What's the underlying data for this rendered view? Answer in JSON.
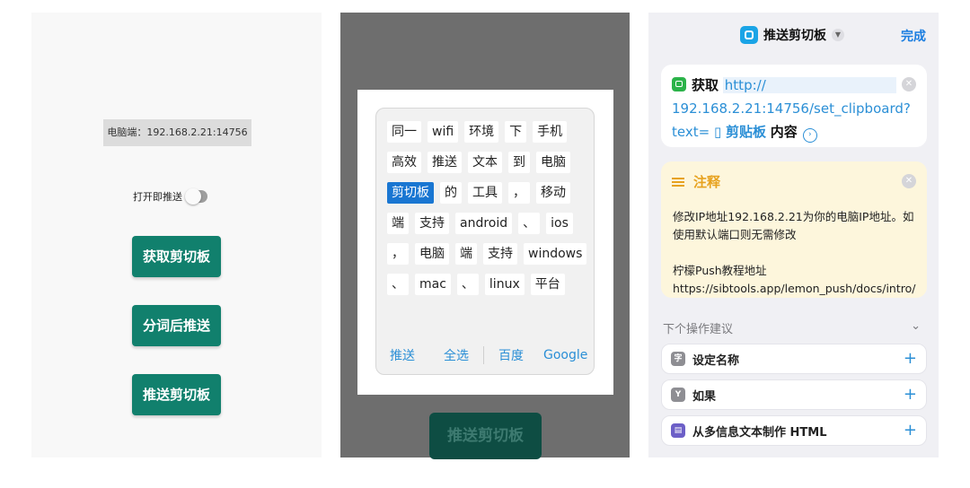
{
  "panel_app": {
    "ip_label": "电脑端：192.168.2.21:14756",
    "toggle_label": "打开即推送",
    "buttons": [
      "获取剪切板",
      "分词后推送",
      "推送剪切板"
    ]
  },
  "panel_dialog": {
    "chips": [
      "同一",
      "wifi",
      "环境",
      "下",
      "手机",
      "高效",
      "推送",
      "文本",
      "到",
      "电脑",
      "剪切板",
      "的",
      "工具",
      "，",
      "移动",
      "端",
      "支持",
      "android",
      "、",
      "ios",
      "，",
      "电脑",
      "端",
      "支持",
      "windows",
      "、",
      "mac",
      "、",
      "linux",
      "平台"
    ],
    "selected_chip": "剪切板",
    "actions": [
      "推送",
      "全选",
      "百度",
      "Google"
    ],
    "background_button": "推送剪切板"
  },
  "panel_shortcut": {
    "title": "推送剪切板",
    "done_label": "完成",
    "get_action": {
      "verb": "获取",
      "url_part1": "http://",
      "url_part2": "192.168.2.21:14756/set_clipboard?",
      "url_part3": "text=",
      "clipboard_token": "剪贴板",
      "suffix": "内容"
    },
    "comment": {
      "title": "注释",
      "body": "修改IP地址192.168.2.21为你的电脑IP地址。如使用默认端口则无需修改\n\n柠檬Push教程地址https://sibtools.app/lemon_push/docs/intro/"
    },
    "suggestions_header": "下个操作建议",
    "suggestions": [
      "设定名称",
      "如果",
      "从多信息文本制作 HTML"
    ]
  },
  "colors": {
    "primary_green": "#11806d",
    "link_blue": "#2b8fd6",
    "selected_chip": "#1976d2",
    "note_bg": "#fdf6dc",
    "note_title": "#e7a21f"
  }
}
